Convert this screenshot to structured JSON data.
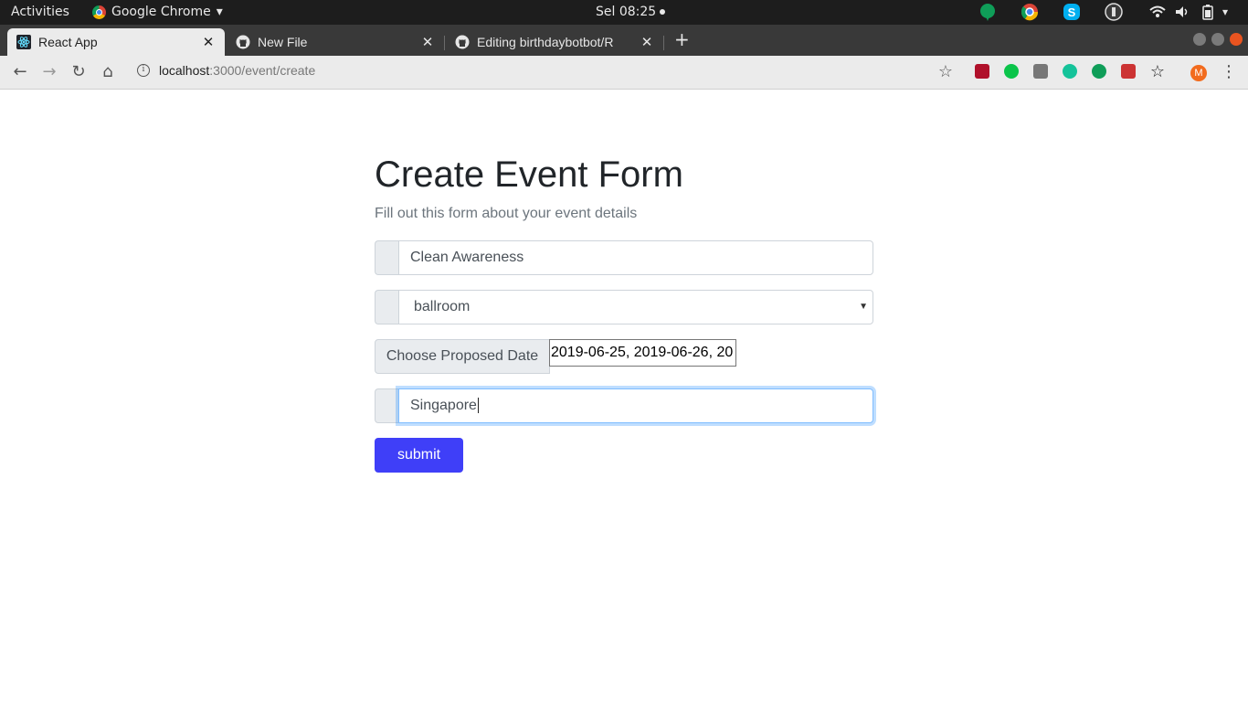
{
  "topbar": {
    "activities": "Activities",
    "app_name": "Google Chrome",
    "app_caret": "▾",
    "clock": "Sel 08:25"
  },
  "tabs": [
    {
      "title": "React App",
      "close": "✕"
    },
    {
      "title": "New File",
      "close": "✕"
    },
    {
      "title": "Editing birthdaybotbot/R",
      "close": "✕"
    }
  ],
  "new_tab": "+",
  "toolbar": {
    "back": "←",
    "forward": "→",
    "reload": "↻",
    "home": "⌂",
    "url_host": "localhost",
    "url_path": ":3000/event/create",
    "bookmark": "☆",
    "profile_initial": "M",
    "menu": "⋮"
  },
  "form": {
    "title": "Create Event Form",
    "subtitle": "Fill out this form about your event details",
    "event_name_value": "Clean Awareness",
    "venue_value": "ballroom",
    "date_button": "Choose Proposed Date",
    "dates_value": "2019-06-25, 2019-06-26, 20",
    "location_value": "Singapore",
    "submit_label": "submit"
  },
  "colors": {
    "submit": "#3f3ff8",
    "topbar": "#1d1d1d",
    "tabstrip": "#393939",
    "window_close": "#e95420"
  }
}
